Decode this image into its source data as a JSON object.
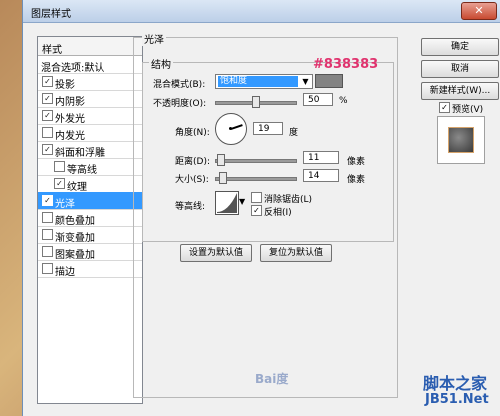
{
  "window": {
    "title": "图层样式"
  },
  "left_panel": {
    "header": "样式",
    "items": [
      {
        "label": "混合选项:默认",
        "checkbox": false,
        "checked": false
      },
      {
        "label": "投影",
        "checkbox": true,
        "checked": true
      },
      {
        "label": "内阴影",
        "checkbox": true,
        "checked": true
      },
      {
        "label": "外发光",
        "checkbox": true,
        "checked": true
      },
      {
        "label": "内发光",
        "checkbox": true,
        "checked": false
      },
      {
        "label": "斜面和浮雕",
        "checkbox": true,
        "checked": true
      },
      {
        "label": "等高线",
        "checkbox": true,
        "checked": false
      },
      {
        "label": "纹理",
        "checkbox": true,
        "checked": true
      },
      {
        "label": "光泽",
        "checkbox": true,
        "checked": true
      },
      {
        "label": "颜色叠加",
        "checkbox": true,
        "checked": false
      },
      {
        "label": "渐变叠加",
        "checkbox": true,
        "checked": false
      },
      {
        "label": "图案叠加",
        "checkbox": true,
        "checked": false
      },
      {
        "label": "描边",
        "checkbox": true,
        "checked": false
      }
    ]
  },
  "satin": {
    "group_title": "光泽",
    "structure_title": "结构",
    "color_hex_annotation": "#838383",
    "blend_mode": {
      "label": "混合模式(B):",
      "value": "饱和度",
      "color": "#838383"
    },
    "opacity": {
      "label": "不透明度(O):",
      "value": "50",
      "unit": "%",
      "percent": 50
    },
    "angle": {
      "label": "角度(N):",
      "value": "19",
      "unit": "度",
      "degrees": 19
    },
    "distance": {
      "label": "距离(D):",
      "value": "11",
      "unit": "像素"
    },
    "size": {
      "label": "大小(S):",
      "value": "14",
      "unit": "像素"
    },
    "contour": {
      "label": "等高线:",
      "anti_alias_label": "消除锯齿(L)",
      "anti_alias": false,
      "invert_label": "反相(I)",
      "invert": true
    },
    "buttons": {
      "make_default": "设置为默认值",
      "reset_default": "复位为默认值"
    }
  },
  "right_panel": {
    "ok": "确定",
    "cancel": "取消",
    "new_style": "新建样式(W)...",
    "preview_label": "预览(V)",
    "preview_checked": true
  },
  "watermarks": {
    "baidu": "Bai度",
    "site_cn": "脚本之家",
    "site_url": "JB51.Net"
  },
  "colors": {
    "selection": "#3399ff",
    "accent_hex_text": "#e0336e"
  }
}
